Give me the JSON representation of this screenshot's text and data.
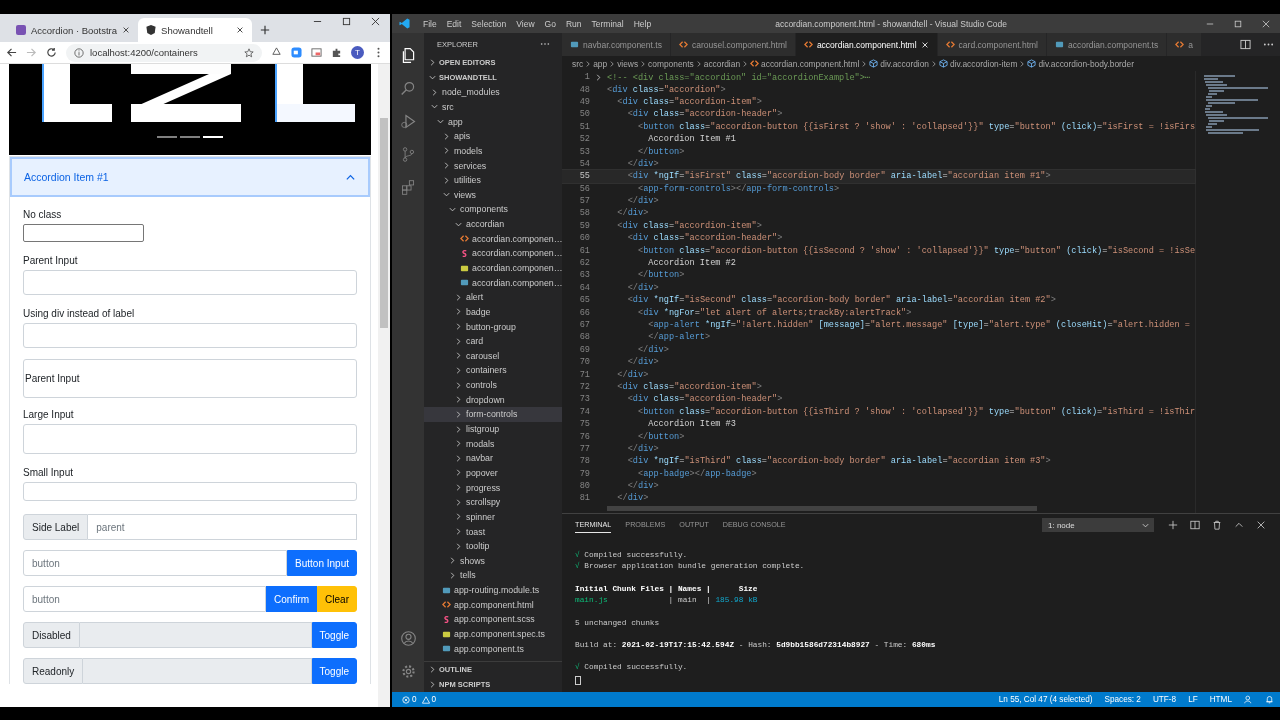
{
  "browser": {
    "tabs": [
      {
        "title": "Accordion · Bootstra",
        "kind": "bootstrap",
        "selected": false
      },
      {
        "title": "Showandtell",
        "kind": "angular",
        "selected": true
      }
    ],
    "url": "localhost:4200/containers",
    "profile": "T",
    "carousel": {
      "indicators": [
        {
          "selected": false
        },
        {
          "selected": false
        },
        {
          "selected": true
        }
      ]
    },
    "accordion": {
      "title": "Accordion Item #1",
      "expanded": true,
      "fields": [
        {
          "kind": "plain",
          "label": "No class"
        },
        {
          "kind": "default",
          "label": "Parent Input"
        },
        {
          "kind": "default",
          "label": "Using div instead of label"
        },
        {
          "kind": "floating",
          "label": "Parent Input"
        },
        {
          "kind": "large",
          "label": "Large Input"
        },
        {
          "kind": "small",
          "label": "Small Input"
        }
      ],
      "groups": [
        {
          "addon": "Side Label",
          "value": "parent",
          "disabled": false
        },
        {
          "placeholder": "button",
          "disabled": false,
          "buttons": [
            {
              "label": "Button Input",
              "color": "#0d6efd"
            }
          ]
        },
        {
          "placeholder": "button",
          "disabled": false,
          "buttons": [
            {
              "label": "Confirm",
              "color": "#0d6efd"
            },
            {
              "label": "Clear",
              "color": "#ffc107"
            }
          ]
        },
        {
          "addon": "Disabled",
          "disabled": true,
          "buttons": [
            {
              "label": "Toggle",
              "color": "#0d6efd"
            }
          ]
        },
        {
          "addon": "Readonly",
          "disabled": true,
          "buttons": [
            {
              "label": "Toggle",
              "color": "#0d6efd"
            }
          ]
        }
      ]
    }
  },
  "vscode": {
    "menu": [
      "File",
      "Edit",
      "Selection",
      "View",
      "Go",
      "Run",
      "Terminal",
      "Help"
    ],
    "title": "accordian.component.html - showandtell - Visual Studio Code",
    "activity": [
      {
        "kind": "files",
        "selected": true
      },
      {
        "kind": "search",
        "selected": false
      },
      {
        "kind": "debug",
        "selected": false
      },
      {
        "kind": "scm",
        "selected": false
      },
      {
        "kind": "extensions",
        "selected": false
      }
    ],
    "explorer": {
      "title": "EXPLORER",
      "open_editors": {
        "title": "OPEN EDITORS",
        "expanded": false
      },
      "project": {
        "title": "SHOWANDTELL",
        "expanded": true,
        "tree": [
          {
            "name": "node_modules",
            "kind": "folder",
            "expanded": false,
            "selected": false
          },
          {
            "name": "src",
            "kind": "folder",
            "expanded": true,
            "selected": false,
            "children": [
              {
                "name": "app",
                "kind": "folder",
                "expanded": true,
                "selected": false,
                "children": [
                  {
                    "name": "apis",
                    "kind": "folder",
                    "expanded": false,
                    "selected": false
                  },
                  {
                    "name": "models",
                    "kind": "folder",
                    "expanded": false,
                    "selected": false
                  },
                  {
                    "name": "services",
                    "kind": "folder",
                    "expanded": false,
                    "selected": false
                  },
                  {
                    "name": "utilities",
                    "kind": "folder",
                    "expanded": false,
                    "selected": false
                  },
                  {
                    "name": "views",
                    "kind": "folder",
                    "expanded": true,
                    "selected": false,
                    "children": [
                      {
                        "name": "components",
                        "kind": "folder",
                        "expanded": true,
                        "selected": false,
                        "children": [
                          {
                            "name": "accordian",
                            "kind": "folder",
                            "expanded": true,
                            "selected": false,
                            "children": [
                              {
                                "name": "accordian.componen…",
                                "kind": "html",
                                "selected": false
                              },
                              {
                                "name": "accordian.componen…",
                                "kind": "scss",
                                "selected": false
                              },
                              {
                                "name": "accordian.componen…",
                                "kind": "spec",
                                "selected": false
                              },
                              {
                                "name": "accordian.componen…",
                                "kind": "ts",
                                "selected": false
                              }
                            ]
                          },
                          {
                            "name": "alert",
                            "kind": "folder",
                            "expanded": false,
                            "selected": false
                          },
                          {
                            "name": "badge",
                            "kind": "folder",
                            "expanded": false,
                            "selected": false
                          },
                          {
                            "name": "button-group",
                            "kind": "folder",
                            "expanded": false,
                            "selected": false
                          },
                          {
                            "name": "card",
                            "kind": "folder",
                            "expanded": false,
                            "selected": false
                          },
                          {
                            "name": "carousel",
                            "kind": "folder",
                            "expanded": false,
                            "selected": false
                          },
                          {
                            "name": "containers",
                            "kind": "folder",
                            "expanded": false,
                            "selected": false
                          },
                          {
                            "name": "controls",
                            "kind": "folder",
                            "expanded": false,
                            "selected": false
                          },
                          {
                            "name": "dropdown",
                            "kind": "folder",
                            "expanded": false,
                            "selected": false
                          },
                          {
                            "name": "form-controls",
                            "kind": "folder",
                            "expanded": false,
                            "selected": true
                          },
                          {
                            "name": "listgroup",
                            "kind": "folder",
                            "expanded": false,
                            "selected": false
                          },
                          {
                            "name": "modals",
                            "kind": "folder",
                            "expanded": false,
                            "selected": false
                          },
                          {
                            "name": "navbar",
                            "kind": "folder",
                            "expanded": false,
                            "selected": false
                          },
                          {
                            "name": "popover",
                            "kind": "folder",
                            "expanded": false,
                            "selected": false
                          },
                          {
                            "name": "progress",
                            "kind": "folder",
                            "expanded": false,
                            "selected": false
                          },
                          {
                            "name": "scrollspy",
                            "kind": "folder",
                            "expanded": false,
                            "selected": false
                          },
                          {
                            "name": "spinner",
                            "kind": "folder",
                            "expanded": false,
                            "selected": false
                          },
                          {
                            "name": "toast",
                            "kind": "folder",
                            "expanded": false,
                            "selected": false
                          },
                          {
                            "name": "tooltip",
                            "kind": "folder",
                            "expanded": false,
                            "selected": false
                          }
                        ]
                      },
                      {
                        "name": "shows",
                        "kind": "folder",
                        "expanded": false,
                        "selected": false
                      },
                      {
                        "name": "tells",
                        "kind": "folder",
                        "expanded": false,
                        "selected": false
                      }
                    ]
                  },
                  {
                    "name": "app-routing.module.ts",
                    "kind": "ts",
                    "selected": false
                  },
                  {
                    "name": "app.component.html",
                    "kind": "html",
                    "selected": false
                  },
                  {
                    "name": "app.component.scss",
                    "kind": "scss",
                    "selected": false
                  },
                  {
                    "name": "app.component.spec.ts",
                    "kind": "spec",
                    "selected": false
                  },
                  {
                    "name": "app.component.ts",
                    "kind": "ts",
                    "selected": false
                  }
                ]
              }
            ]
          }
        ]
      },
      "outline": {
        "title": "OUTLINE",
        "expanded": false
      },
      "npm_scripts": {
        "title": "NPM SCRIPTS",
        "expanded": false
      }
    },
    "editor_tabs": [
      {
        "label": "navbar.component.ts",
        "kind": "ts",
        "selected": false
      },
      {
        "label": "carousel.component.html",
        "kind": "html",
        "selected": false
      },
      {
        "label": "accordian.component.html",
        "kind": "html",
        "selected": true
      },
      {
        "label": "card.component.html",
        "kind": "html",
        "selected": false
      },
      {
        "label": "accordian.component.ts",
        "kind": "ts",
        "selected": false
      },
      {
        "label": "a",
        "kind": "html",
        "selected": false
      }
    ],
    "breadcrumbs": [
      {
        "label": "src",
        "kind": "folder"
      },
      {
        "label": "app",
        "kind": "folder"
      },
      {
        "label": "views",
        "kind": "folder"
      },
      {
        "label": "components",
        "kind": "folder"
      },
      {
        "label": "accordian",
        "kind": "folder"
      },
      {
        "label": "accordian.component.html",
        "kind": "html"
      },
      {
        "label": "div.accordion",
        "kind": "element"
      },
      {
        "label": "div.accordion-item",
        "kind": "element"
      },
      {
        "label": "div.accordion-body.border",
        "kind": "element"
      }
    ],
    "code": [
      {
        "number": "1",
        "kind": "folded",
        "current": false,
        "text": "<!-- <div class=\"accordion\" id=\"accordionExample\">⋯"
      },
      {
        "number": "48",
        "kind": "code",
        "current": false,
        "text": "<div class=\"accordion\">"
      },
      {
        "number": "49",
        "kind": "code",
        "current": false,
        "text": "  <div class=\"accordion-item\">"
      },
      {
        "number": "50",
        "kind": "code",
        "current": false,
        "text": "    <div class=\"accordion-header\">"
      },
      {
        "number": "51",
        "kind": "code",
        "current": false,
        "text": "      <button class=\"accordion-button {{isFirst ? 'show' : 'collapsed'}}\" type=\"button\" (click)=\"isFirst = !isFirs"
      },
      {
        "number": "52",
        "kind": "code",
        "current": false,
        "text": "        Accordion Item #1"
      },
      {
        "number": "53",
        "kind": "code",
        "current": false,
        "text": "      </button>"
      },
      {
        "number": "54",
        "kind": "code",
        "current": false,
        "text": "    </div>"
      },
      {
        "number": "55",
        "kind": "code",
        "current": true,
        "text": "    <div *ngIf=\"isFirst\" class=\"accordion-body border\" aria-label=\"accordian item #1\">"
      },
      {
        "number": "56",
        "kind": "code",
        "current": false,
        "text": "      <app-form-controls></app-form-controls>"
      },
      {
        "number": "57",
        "kind": "code",
        "current": false,
        "text": "    </div>"
      },
      {
        "number": "58",
        "kind": "code",
        "current": false,
        "text": "  </div>"
      },
      {
        "number": "59",
        "kind": "code",
        "current": false,
        "text": "  <div class=\"accordion-item\">"
      },
      {
        "number": "60",
        "kind": "code",
        "current": false,
        "text": "    <div class=\"accordion-header\">"
      },
      {
        "number": "61",
        "kind": "code",
        "current": false,
        "text": "      <button class=\"accordion-button {{isSecond ? 'show' : 'collapsed'}}\" type=\"button\" (click)=\"isSecond = !isSe"
      },
      {
        "number": "62",
        "kind": "code",
        "current": false,
        "text": "        Accordion Item #2"
      },
      {
        "number": "63",
        "kind": "code",
        "current": false,
        "text": "      </button>"
      },
      {
        "number": "64",
        "kind": "code",
        "current": false,
        "text": "    </div>"
      },
      {
        "number": "65",
        "kind": "code",
        "current": false,
        "text": "    <div *ngIf=\"isSecond\" class=\"accordion-body border\" aria-label=\"accordian item #2\">"
      },
      {
        "number": "66",
        "kind": "code",
        "current": false,
        "text": "      <div *ngFor=\"let alert of alerts;trackBy:alertTrack\">"
      },
      {
        "number": "67",
        "kind": "code",
        "current": false,
        "text": "        <app-alert *ngIf=\"!alert.hidden\" [message]=\"alert.message\" [type]=\"alert.type\" (closeHit)=\"alert.hidden ="
      },
      {
        "number": "68",
        "kind": "code",
        "current": false,
        "text": "        </app-alert>"
      },
      {
        "number": "69",
        "kind": "code",
        "current": false,
        "text": "      </div>"
      },
      {
        "number": "70",
        "kind": "code",
        "current": false,
        "text": "    </div>"
      },
      {
        "number": "71",
        "kind": "code",
        "current": false,
        "text": "  </div>"
      },
      {
        "number": "72",
        "kind": "code",
        "current": false,
        "text": "  <div class=\"accordion-item\">"
      },
      {
        "number": "73",
        "kind": "code",
        "current": false,
        "text": "    <div class=\"accordion-header\">"
      },
      {
        "number": "74",
        "kind": "code",
        "current": false,
        "text": "      <button class=\"accordion-button {{isThird ? 'show' : 'collapsed'}}\" type=\"button\" (click)=\"isThird = !isThir"
      },
      {
        "number": "75",
        "kind": "code",
        "current": false,
        "text": "        Accordion Item #3"
      },
      {
        "number": "76",
        "kind": "code",
        "current": false,
        "text": "      </button>"
      },
      {
        "number": "77",
        "kind": "code",
        "current": false,
        "text": "    </div>"
      },
      {
        "number": "78",
        "kind": "code",
        "current": false,
        "text": "    <div *ngIf=\"isThird\" class=\"accordion-body border\" aria-label=\"accordian item #3\">"
      },
      {
        "number": "79",
        "kind": "code",
        "current": false,
        "text": "      <app-badge></app-badge>"
      },
      {
        "number": "80",
        "kind": "code",
        "current": false,
        "text": "    </div>"
      },
      {
        "number": "81",
        "kind": "code",
        "current": false,
        "text": "  </div>"
      }
    ],
    "panel_tabs": [
      {
        "label": "TERMINAL",
        "selected": true
      },
      {
        "label": "PROBLEMS",
        "selected": false
      },
      {
        "label": "OUTPUT",
        "selected": false
      },
      {
        "label": "DEBUG CONSOLE",
        "selected": false
      }
    ],
    "terminal_select": "1: node",
    "terminal": [
      {
        "gap_before": false,
        "segments": [
          {
            "text": "√",
            "kind": "green"
          },
          {
            "text": " Compiled successfully.",
            "kind": "plain"
          }
        ]
      },
      {
        "gap_before": false,
        "segments": [
          {
            "text": "√",
            "kind": "green"
          },
          {
            "text": " Browser application bundle generation complete.",
            "kind": "plain"
          }
        ]
      },
      {
        "gap_before": true,
        "segments": [
          {
            "text": "Initial Chunk Files | Names |      Size",
            "kind": "bold"
          }
        ]
      },
      {
        "gap_before": false,
        "segments": [
          {
            "text": "main.js",
            "kind": "green"
          },
          {
            "text": "             | main  | ",
            "kind": "plain"
          },
          {
            "text": "185.98 kB",
            "kind": "cyan"
          }
        ]
      },
      {
        "gap_before": true,
        "segments": [
          {
            "text": "5 unchanged chunks",
            "kind": "plain"
          }
        ]
      },
      {
        "gap_before": true,
        "segments": [
          {
            "text": "Build at: ",
            "kind": "plain"
          },
          {
            "text": "2021-02-19T17:15:42.594Z",
            "kind": "bold"
          },
          {
            "text": " - Hash: ",
            "kind": "plain"
          },
          {
            "text": "5d9bb1586d72314b8927",
            "kind": "bold"
          },
          {
            "text": " - Time: ",
            "kind": "plain"
          },
          {
            "text": "680ms",
            "kind": "bold"
          }
        ]
      },
      {
        "gap_before": true,
        "segments": [
          {
            "text": "√",
            "kind": "green"
          },
          {
            "text": " Compiled successfully.",
            "kind": "plain"
          }
        ]
      }
    ],
    "status_bar": {
      "errors": "0",
      "warnings": "0",
      "items": [
        "Ln 55, Col 47 (4 selected)",
        "Spaces: 2",
        "UTF-8",
        "LF",
        "HTML"
      ]
    }
  }
}
